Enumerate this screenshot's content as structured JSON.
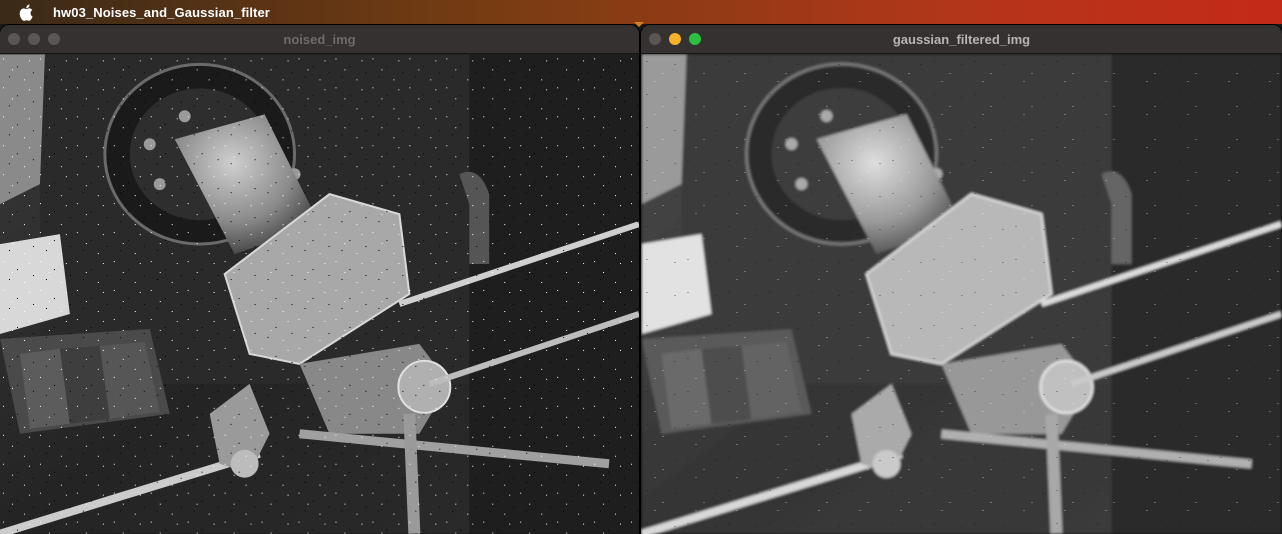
{
  "menubar": {
    "app_name": "hw03_Noises_and_Gaussian_filter",
    "apple_icon": "apple-logo-icon"
  },
  "windows": [
    {
      "title": "noised_img",
      "active": false
    },
    {
      "title": "gaussian_filtered_img",
      "active": true
    }
  ],
  "colors": {
    "menubar_gradient": [
      "#3a2a18",
      "#7a3d12",
      "#b4361a",
      "#c42a18"
    ],
    "titlebar": "#353130",
    "minimize_light": "#f5b12a",
    "maximize_light": "#2ac03f"
  }
}
